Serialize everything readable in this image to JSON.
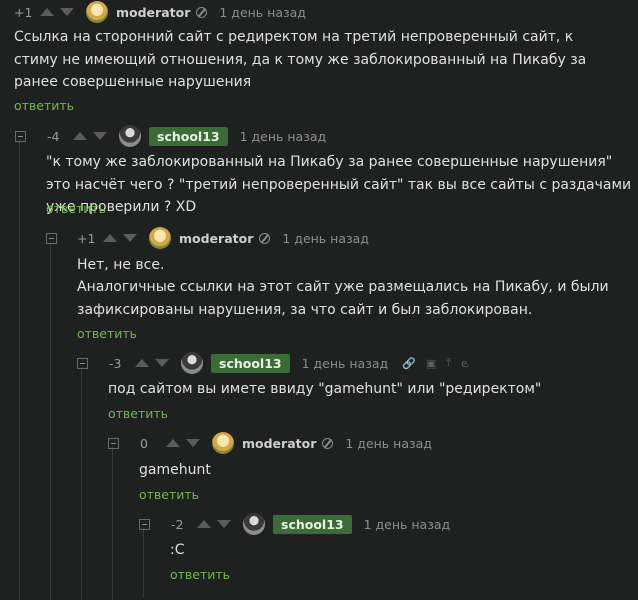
{
  "comments": [
    {
      "rating": "+1",
      "author": "moderator",
      "time": "1 день назад",
      "text": "Ссылка на сторонний сайт с редиректом на третий непроверенный сайт, к стиму не имеющий отношения, да к тому же заблокированный на Пикабу за ранее совершенные нарушения",
      "reply": "ответить"
    },
    {
      "rating": "-4",
      "author": "school13",
      "time": "1 день назад",
      "text": "\"к тому же заблокированный на Пикабу за ранее совершенные нарушения\" это насчёт чего ? \"третий непроверенный сайт\" так вы все сайты с раздачами уже проверили ? XD",
      "reply": "ответить"
    },
    {
      "rating": "+1",
      "author": "moderator",
      "time": "1 день назад",
      "text_line1": "Нет, не все.",
      "text_line2": "Аналогичные ссылки на этот сайт уже размещались на Пикабу, и были зафиксированы нарушения, за что сайт и был заблокирован.",
      "reply": "ответить"
    },
    {
      "rating": "-3",
      "author": "school13",
      "time": "1 день назад",
      "text": "под сайтом вы имете ввиду \"gamehunt\" или \"редиректом\"",
      "reply": "ответить"
    },
    {
      "rating": "0",
      "author": "moderator",
      "time": "1 день назад",
      "text": "gamehunt",
      "reply": "ответить"
    },
    {
      "rating": "-2",
      "author": "school13",
      "time": "1 день назад",
      "text": ":C",
      "reply": "ответить"
    }
  ],
  "icons": {
    "link": "🔗",
    "save": "▣",
    "pin": "⤒",
    "more": "ⱸ"
  }
}
